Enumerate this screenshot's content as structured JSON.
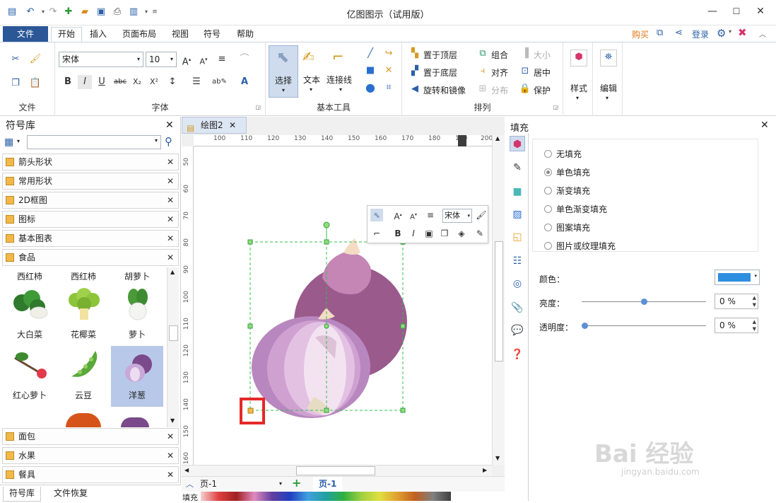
{
  "window": {
    "title": "亿图图示（试用版）"
  },
  "menu": {
    "file": "文件",
    "tabs": [
      "开始",
      "插入",
      "页面布局",
      "视图",
      "符号",
      "帮助"
    ],
    "buy": "购买",
    "login": "登录"
  },
  "ribbon": {
    "groups": {
      "file": "文件",
      "font": "字体",
      "basic_tools": "基本工具",
      "arrange": "排列",
      "style": "样式",
      "edit": "编辑"
    },
    "font_name": "宋体",
    "font_size": "10",
    "tools": {
      "select": "选择",
      "text": "文本",
      "connector": "连接线"
    },
    "arrange": {
      "top": "置于顶层",
      "bottom": "置于底层",
      "rotate": "旋转和镜像",
      "group": "组合",
      "align": "对齐",
      "distribute": "分布",
      "size": "大小",
      "center": "居中",
      "protect": "保护"
    }
  },
  "left_panel": {
    "title": "符号库",
    "categories_top": [
      "箭头形状",
      "常用形状",
      "2D框图",
      "图标",
      "基本图表",
      "食品"
    ],
    "shapes_row0": [
      "西红柿",
      "西红柿",
      "胡萝卜"
    ],
    "shapes_row1": [
      "大白菜",
      "花椰菜",
      "萝卜"
    ],
    "shapes_row2": [
      "红心萝卜",
      "云豆",
      "洋葱"
    ],
    "categories_bottom": [
      "面包",
      "水果",
      "餐具"
    ],
    "bottom_tabs": [
      "符号库",
      "文件恢复"
    ]
  },
  "canvas": {
    "doc_tab": "绘图2",
    "hruler": [
      "100",
      "110",
      "120",
      "130",
      "140",
      "150",
      "160",
      "170",
      "180",
      "190",
      "200"
    ],
    "vruler": [
      "50",
      "60",
      "70",
      "80",
      "90",
      "100",
      "110",
      "120",
      "130",
      "140",
      "150",
      "160"
    ],
    "floatbar_font": "宋体",
    "page_select": "页-1",
    "page_tab": "页-1",
    "fill_label": "填充"
  },
  "right_panel": {
    "title": "填充",
    "options": [
      "无填充",
      "单色填充",
      "渐变填充",
      "单色渐变填充",
      "图案填充",
      "图片或纹理填充"
    ],
    "selected_option": "单色填充",
    "color_label": "颜色：",
    "brightness_label": "亮度：",
    "brightness_value": "0 %",
    "transparency_label": "透明度：",
    "transparency_value": "0 %",
    "color_value": "#2e8fe0"
  },
  "watermark": {
    "text": "Bai 经验",
    "sub": "jingyan.baidu.com"
  }
}
